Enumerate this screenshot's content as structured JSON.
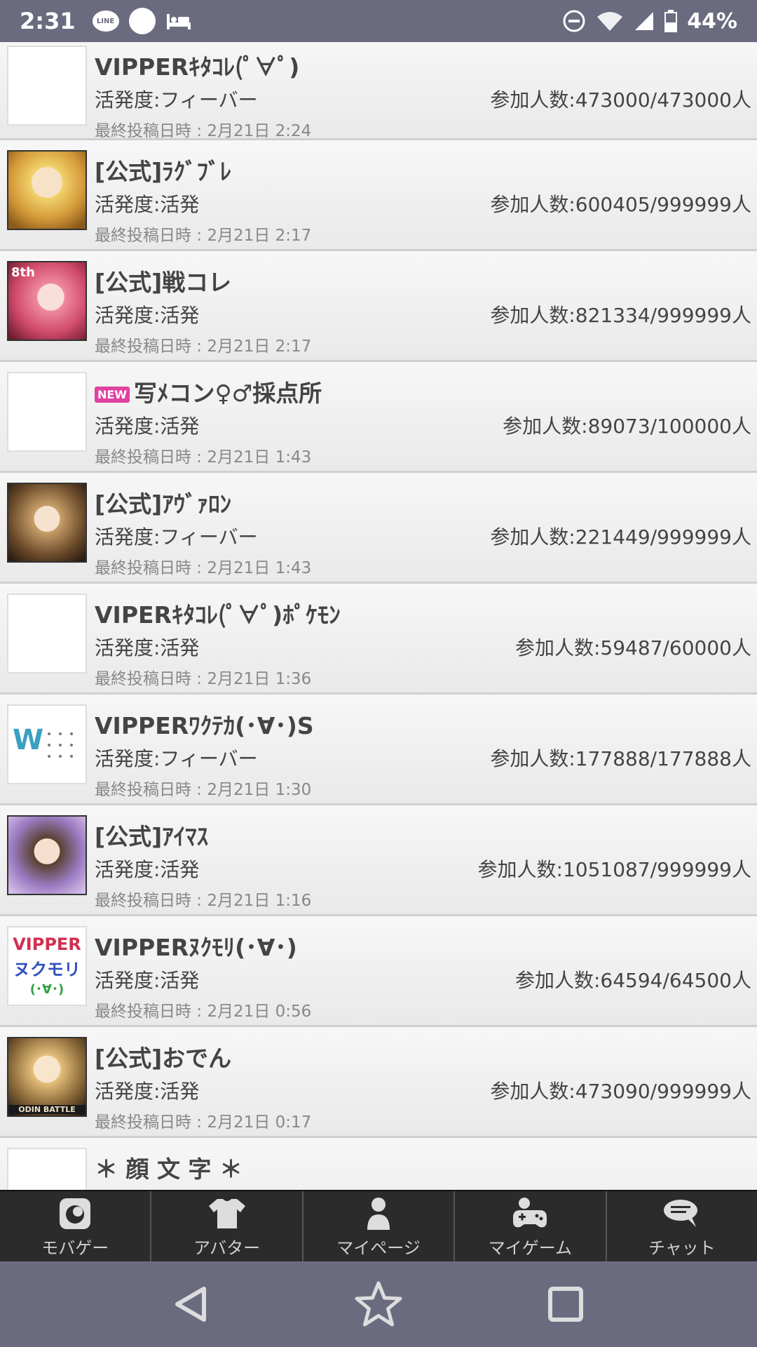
{
  "status_bar": {
    "time": "2:31",
    "line_label": "LINE",
    "battery": "44%"
  },
  "rows": [
    {
      "title": "VIPPERｷﾀｺﾚ(ﾟ∀ﾟ)",
      "activity": "活発度:フィーバー",
      "count": "参加人数:473000/473000人",
      "time": "最終投稿日時 : 2月21日 2:24",
      "new": false
    },
    {
      "title": "[公式]ﾗｸﾞﾌﾞﾚ",
      "activity": "活発度:活発",
      "count": "参加人数:600405/999999人",
      "time": "最終投稿日時 : 2月21日 2:17",
      "new": false
    },
    {
      "title": "[公式]戦コレ",
      "activity": "活発度:活発",
      "count": "参加人数:821334/999999人",
      "time": "最終投稿日時 : 2月21日 2:17",
      "new": false
    },
    {
      "title": "写ﾒコン♀♂採点所",
      "activity": "活発度:活発",
      "count": "参加人数:89073/100000人",
      "time": "最終投稿日時 : 2月21日 1:43",
      "new": true,
      "new_label": "NEW"
    },
    {
      "title": "[公式]ｱｳﾞｧﾛﾝ",
      "activity": "活発度:フィーバー",
      "count": "参加人数:221449/999999人",
      "time": "最終投稿日時 : 2月21日 1:43",
      "new": false
    },
    {
      "title": "VIPERｷﾀｺﾚ(ﾟ∀ﾟ)ﾎﾟｹﾓﾝ",
      "activity": "活発度:活発",
      "count": "参加人数:59487/60000人",
      "time": "最終投稿日時 : 2月21日 1:36",
      "new": false
    },
    {
      "title": "VIPPERﾜｸﾃｶ(･∀･)S",
      "activity": "活発度:フィーバー",
      "count": "参加人数:177888/177888人",
      "time": "最終投稿日時 : 2月21日 1:30",
      "new": false
    },
    {
      "title": "[公式]ｱｲﾏｽ",
      "activity": "活発度:活発",
      "count": "参加人数:1051087/999999人",
      "time": "最終投稿日時 : 2月21日 1:16",
      "new": false
    },
    {
      "title": "VIPPERﾇｸﾓﾘ(･∀･)",
      "activity": "活発度:活発",
      "count": "参加人数:64594/64500人",
      "time": "最終投稿日時 : 2月21日 0:56",
      "new": false
    },
    {
      "title": "[公式]おでん",
      "activity": "活発度:活発",
      "count": "参加人数:473090/999999人",
      "time": "最終投稿日時 : 2月21日 0:17",
      "new": false
    },
    {
      "title": "＊ 顔 文 字 ＊",
      "activity": "",
      "count": "",
      "time": "",
      "new": false
    }
  ],
  "thumb_texts": {
    "vipper_nukumori": "VIPPER",
    "vipper_nukumori_2": "ヌクモリ",
    "vipper_nukumori_3": "(･∀･)",
    "oden": "ODIN BATTLE",
    "senkore": "8th"
  },
  "bottom_nav": [
    {
      "label": "モバゲー",
      "icon": "mobage-icon"
    },
    {
      "label": "アバター",
      "icon": "tshirt-icon"
    },
    {
      "label": "マイページ",
      "icon": "person-icon"
    },
    {
      "label": "マイゲーム",
      "icon": "gamepad-icon"
    },
    {
      "label": "チャット",
      "icon": "chat-icon"
    }
  ],
  "colors": {
    "status_bar": "#6b6b80",
    "nav_bg": "#2b2b2b",
    "new_badge": "#e040a0"
  }
}
